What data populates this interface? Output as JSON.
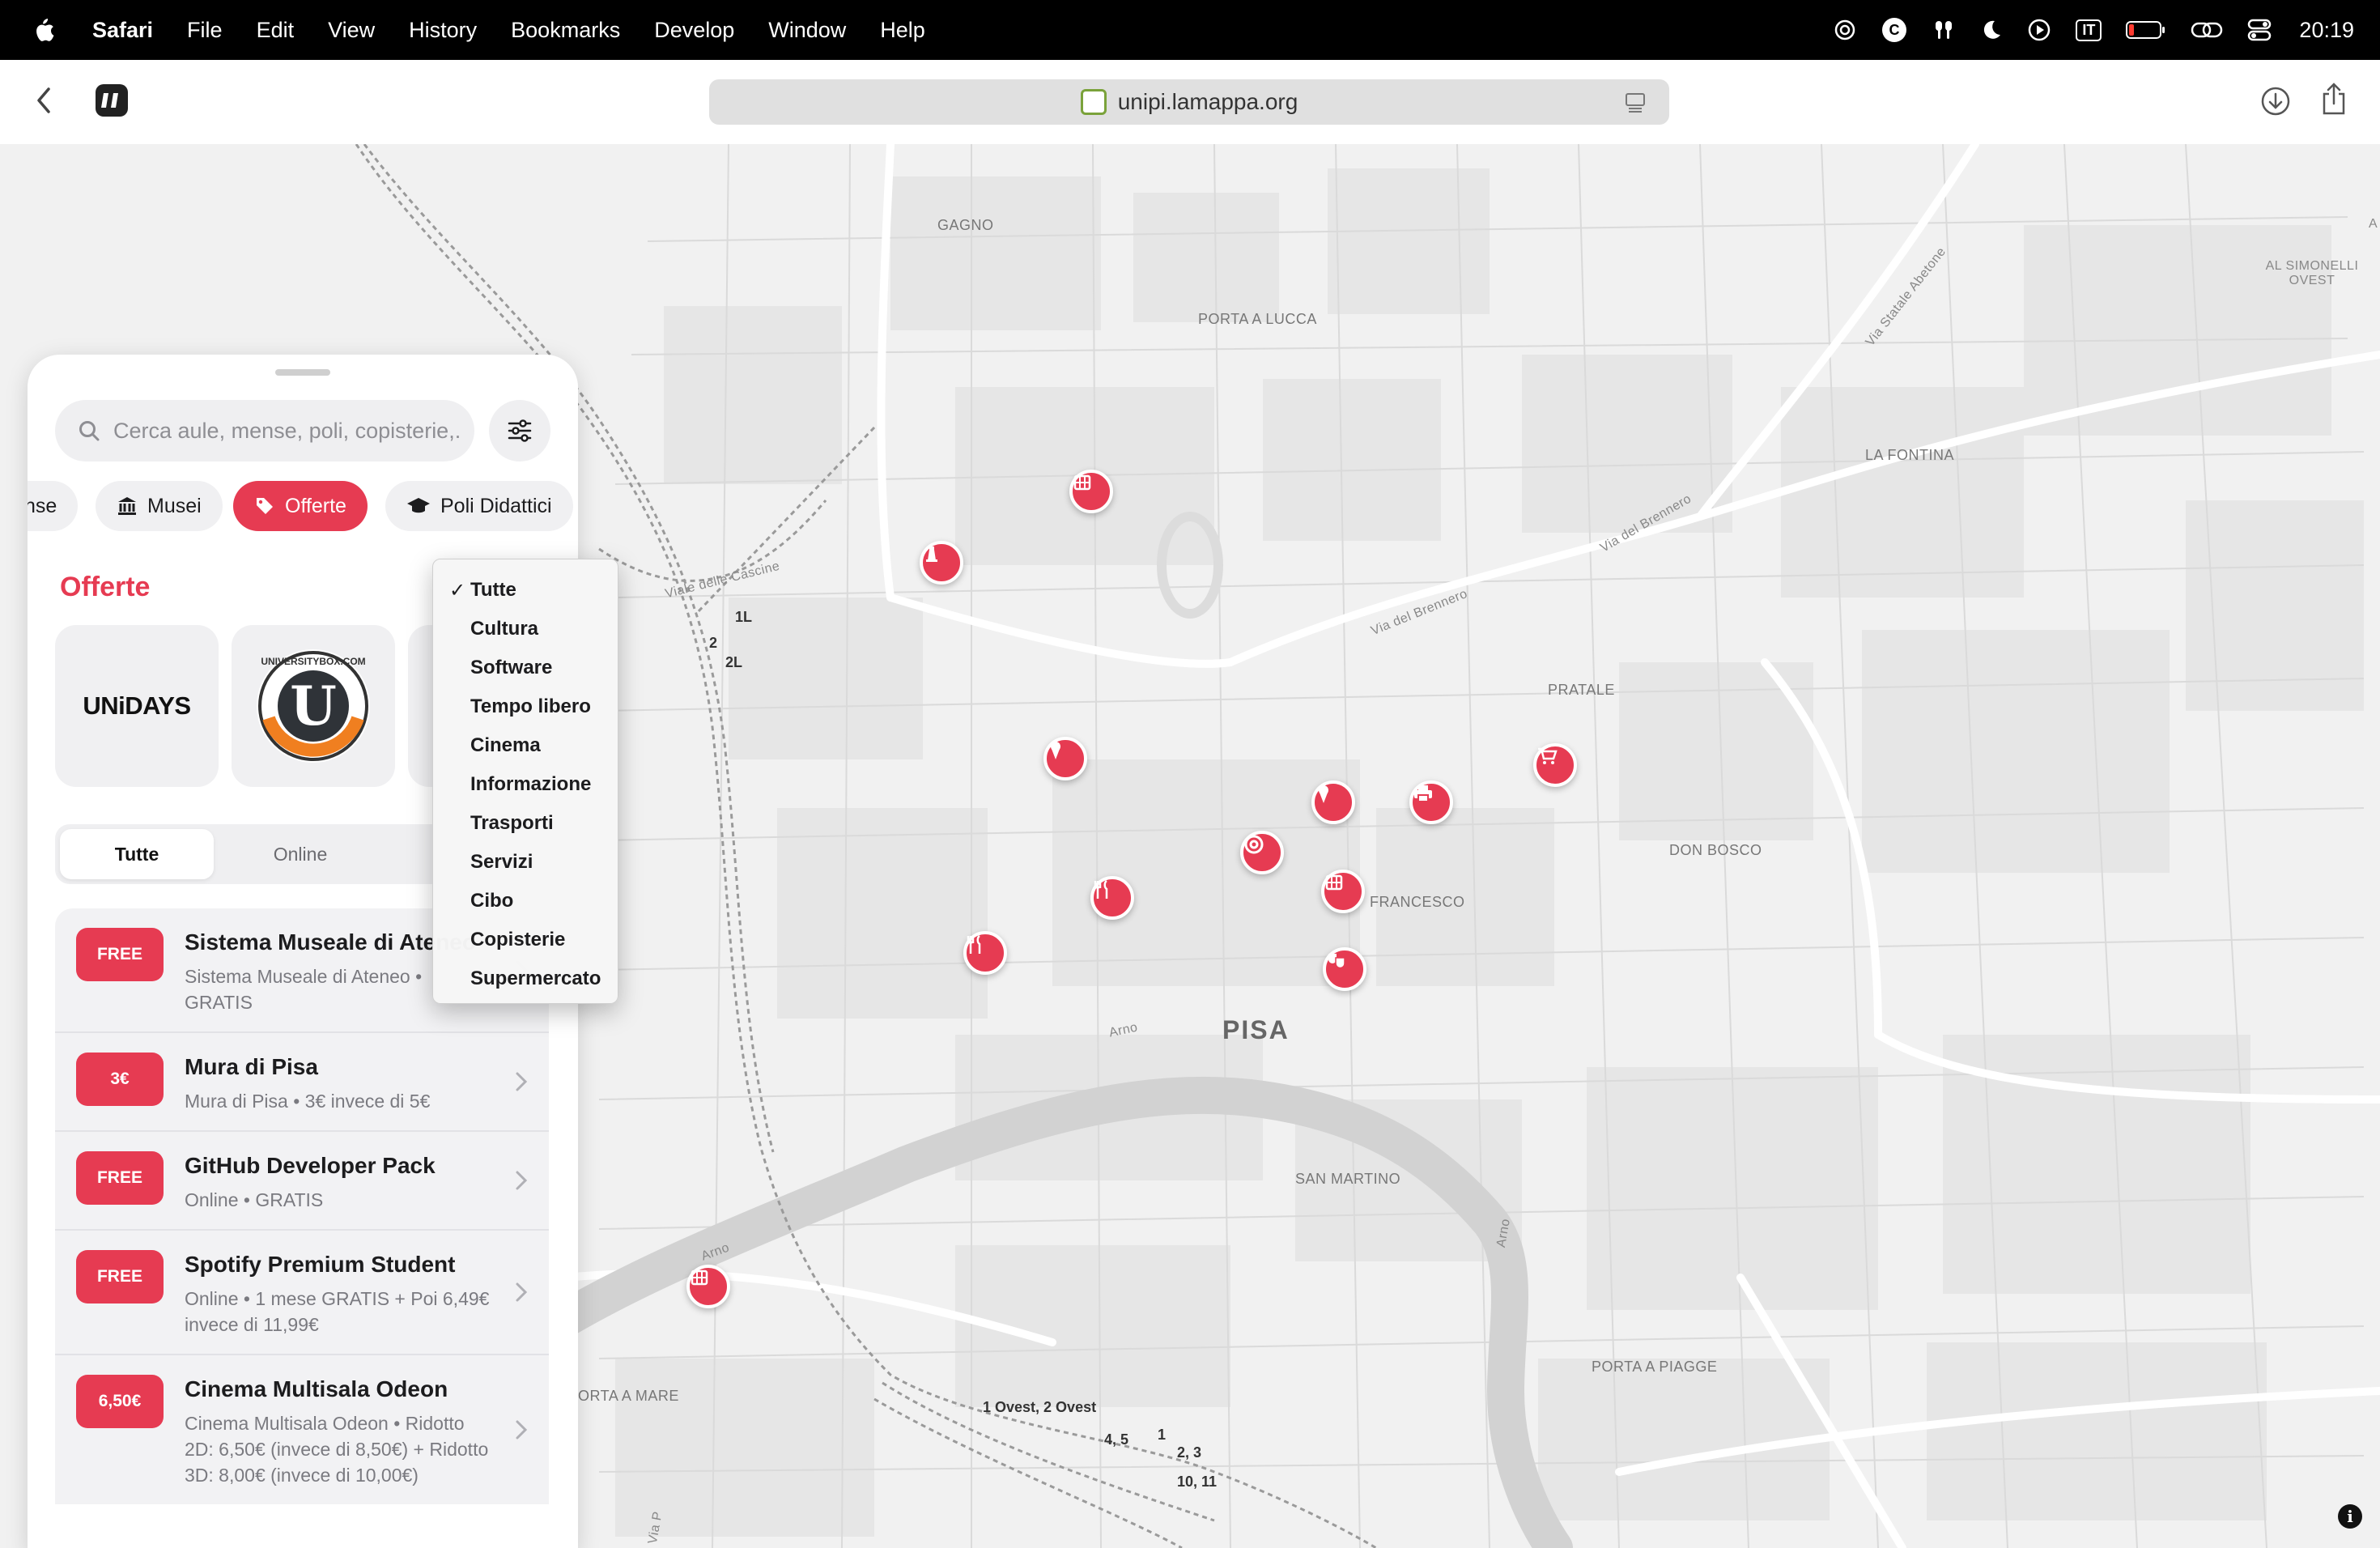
{
  "menubar": {
    "app": "Safari",
    "items": [
      "File",
      "Edit",
      "View",
      "History",
      "Bookmarks",
      "Develop",
      "Window",
      "Help"
    ],
    "lang": "IT",
    "time": "20:19"
  },
  "browser": {
    "url": "unipi.lamappa.org"
  },
  "search": {
    "placeholder": "Cerca aule, mense, poli, copisterie,..."
  },
  "chips": [
    "nse",
    "Musei",
    "Offerte",
    "Poli Didattici"
  ],
  "section_title": "Offerte",
  "brands": [
    "UNiDAYS",
    "UNIVERSITYBOX.COM"
  ],
  "segment": [
    "Tutte",
    "Online"
  ],
  "offers": [
    {
      "badge": "FREE",
      "title": "Sistema Museale di Ateneo",
      "subtitle": "Sistema Museale di Ateneo • GRATIS"
    },
    {
      "badge": "3€",
      "title": "Mura di Pisa",
      "subtitle": "Mura di Pisa • 3€ invece di 5€"
    },
    {
      "badge": "FREE",
      "title": "GitHub Developer Pack",
      "subtitle": "Online • GRATIS"
    },
    {
      "badge": "FREE",
      "title": "Spotify Premium Student",
      "subtitle": "Online • 1 mese GRATIS + Poi 6,49€ invece di 11,99€"
    },
    {
      "badge": "6,50€",
      "title": "Cinema Multisala Odeon",
      "subtitle": "Cinema Multisala Odeon • Ridotto 2D: 6,50€ (invece di 8,50€) + Ridotto 3D: 8,00€ (invece di 10,00€)"
    }
  ],
  "dropdown": {
    "selected": "Tutte",
    "options": [
      "Tutte",
      "Cultura",
      "Software",
      "Tempo libero",
      "Cinema",
      "Informazione",
      "Trasporti",
      "Servizi",
      "Cibo",
      "Copisterie",
      "Supermercato"
    ]
  },
  "map": {
    "labels": {
      "gagno": "GAGNO",
      "porta_lucca": "PORTA A LUCCA",
      "simonelli": "AL SIMONELLI OVEST",
      "fontina": "LA FONTINA",
      "pratale": "PRATALE",
      "don_bosco": "DON BOSCO",
      "francesco": "FRANCESCO",
      "pisa": "PISA",
      "san_martino": "SAN MARTINO",
      "porta_mare": "ORTA A MARE",
      "porta_piagge": "PORTA A PIAGGE",
      "via_brennero_1": "Via del Brennero",
      "via_brennero_2": "Via del Brennero",
      "via_abetone": "Via Statale Abetone",
      "viale_cascine": "Viale delle Cascine",
      "arno_1": "Arno",
      "arno_2": "Arno",
      "arno_3": "Arno",
      "via_p": "Via P",
      "a_edge": "A"
    },
    "rail_labels": [
      "1L",
      "2",
      "2L",
      "1 Ovest, 2 Ovest",
      "1",
      "4, 5",
      "2, 3",
      "10, 11"
    ]
  }
}
